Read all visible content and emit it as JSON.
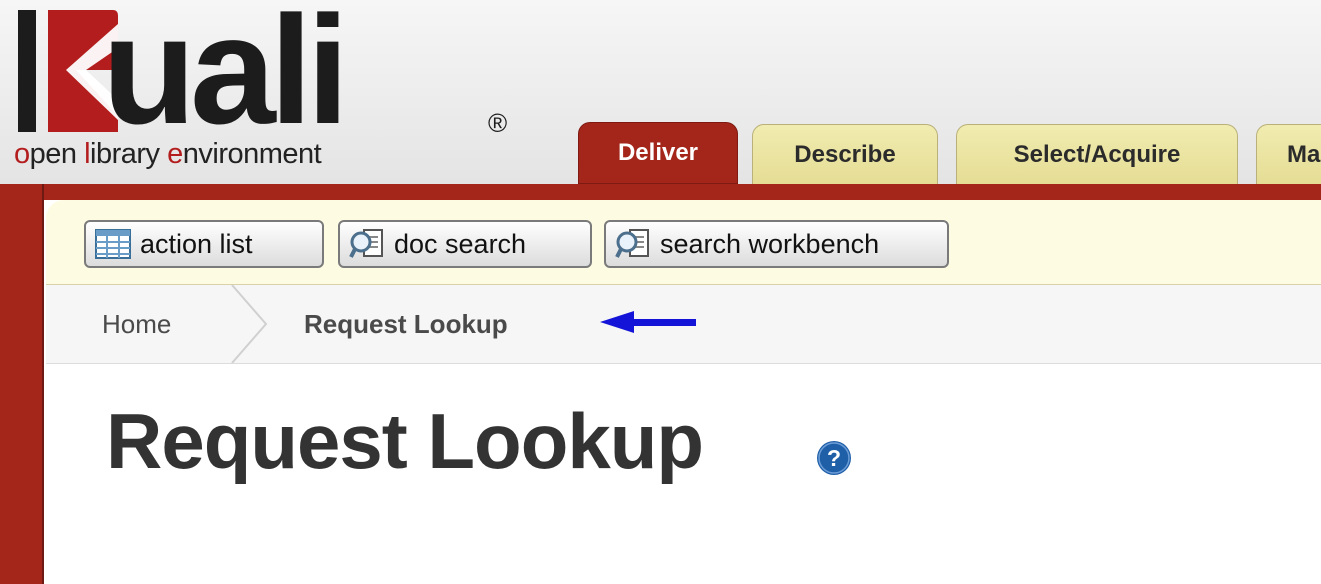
{
  "logo": {
    "word": "uali",
    "registered": "®",
    "tagline": [
      {
        "text": "o",
        "accent": true
      },
      {
        "text": "pen ",
        "accent": false
      },
      {
        "text": "l",
        "accent": true
      },
      {
        "text": "ibrary ",
        "accent": false
      },
      {
        "text": "e",
        "accent": true
      },
      {
        "text": "nvironment",
        "accent": false
      }
    ]
  },
  "tabs": [
    {
      "label": "Deliver",
      "active": true
    },
    {
      "label": "Describe",
      "active": false
    },
    {
      "label": "Select/Acquire",
      "active": false
    },
    {
      "label": "Ma",
      "active": false
    }
  ],
  "toolbar": {
    "action_list": "action list",
    "doc_search": "doc search",
    "search_workbench": "search workbench"
  },
  "breadcrumb": {
    "home": "Home",
    "current": "Request Lookup"
  },
  "page": {
    "title": "Request Lookup"
  },
  "colors": {
    "brand_red": "#a4261a",
    "tab_inactive": "#e8e09c",
    "toolbar_bg": "#fdfbe2",
    "arrow_blue": "#1414d8",
    "help_blue": "#1f5fa8"
  }
}
